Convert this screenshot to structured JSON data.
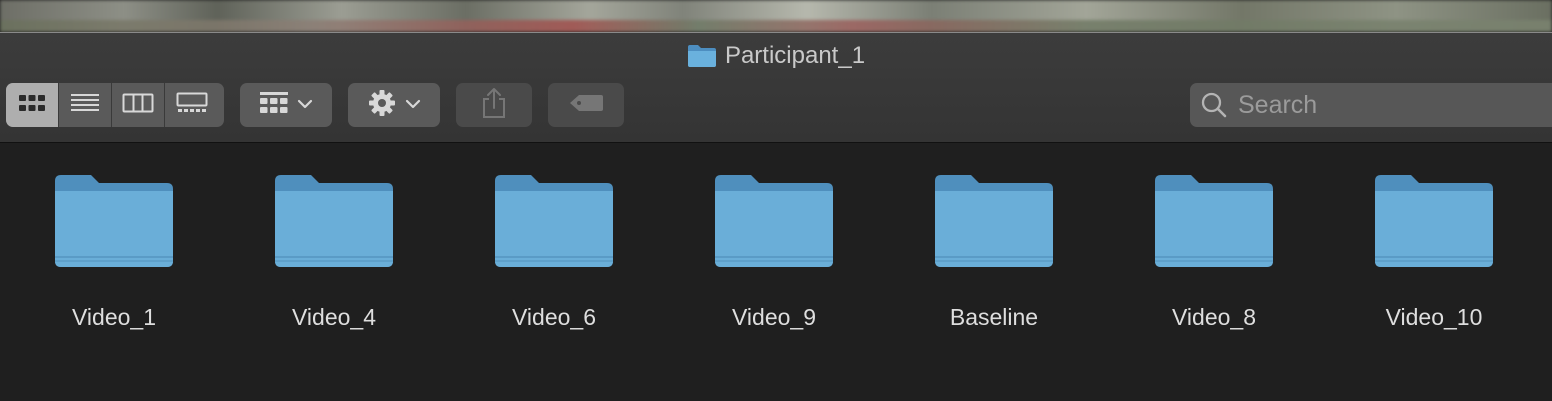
{
  "window": {
    "title": "Participant_1",
    "title_icon": "folder-icon"
  },
  "toolbar": {
    "view_modes": [
      {
        "icon": "icon-view-icon",
        "active": true
      },
      {
        "icon": "list-view-icon",
        "active": false
      },
      {
        "icon": "column-view-icon",
        "active": false
      },
      {
        "icon": "gallery-view-icon",
        "active": false
      }
    ],
    "group_icon": "group-by-icon",
    "action_icon": "gear-icon",
    "share_icon": "share-icon",
    "tag_icon": "tag-icon"
  },
  "search": {
    "placeholder": "Search",
    "icon": "search-icon"
  },
  "folders": [
    {
      "name": "Video_1"
    },
    {
      "name": "Video_4"
    },
    {
      "name": "Video_6"
    },
    {
      "name": "Video_9"
    },
    {
      "name": "Baseline"
    },
    {
      "name": "Video_8"
    },
    {
      "name": "Video_10"
    }
  ],
  "colors": {
    "folder_blue": "#6aaed8",
    "folder_tab": "#4f8fbd",
    "window_bg": "#1f1f1f",
    "titlebar_bg": "#3a3a3a"
  }
}
